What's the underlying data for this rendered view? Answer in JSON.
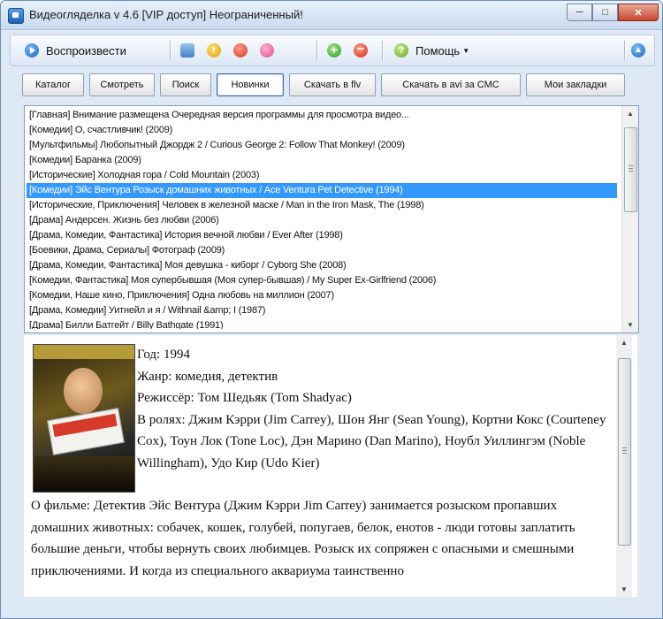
{
  "window": {
    "title": "Видеогляделка v 4.6 [VIP доступ] Неограниченный!"
  },
  "toolbar": {
    "play_label": "Воспроизвести",
    "help_label": "Помощь"
  },
  "tabs": [
    {
      "label": "Каталог"
    },
    {
      "label": "Смотреть"
    },
    {
      "label": "Поиск"
    },
    {
      "label": "Новинки"
    },
    {
      "label": "Скачать в flv"
    },
    {
      "label": "Скачать в avi за СМС"
    },
    {
      "label": "Мои закладки"
    }
  ],
  "list": {
    "selected_index": 5,
    "items": [
      "[Главная] Внимание размещена Очередная версия программы для просмотра видео...",
      "[Комедии] О, счастливчик! (2009)",
      "[Мультфильмы] Любопытный Джордж 2 / Curious George 2: Follow That Monkey! (2009)",
      "[Комедии] Баранка (2009)",
      "[Исторические] Холодная гора / Cold Mountain (2003)",
      "[Комедии] Эйс Вентура Розыск домашних животных / Ace Ventura Pet Detective (1994)",
      "[Исторические, Приключения] Человек в железной маске / Man in the Iron Mask, The (1998)",
      "[Драма] Андерсен. Жизнь без любви (2006)",
      "[Драма, Комедии, Фантастика] История вечной любви / Ever After (1998)",
      "[Боевики, Драма, Сериалы] Фотограф (2009)",
      "[Драма, Комедии, Фантастика] Моя девушка - киборг / Cyborg She (2008)",
      "[Комедии, Фантастика] Моя супербывшая (Моя супер-бывшая) / My Super Ex-Girlfriend (2006)",
      "[Комедии, Наше кино, Приключения] Одна любовь на миллион (2007)",
      "[Драма, Комедии] Уитнейл и я / Withnail &amp; I (1987)",
      "[Драма] Билли Батгейт / Billy Bathgate (1991)"
    ]
  },
  "details": {
    "year": "Год: 1994",
    "genre": "Жанр: комедия, детектив",
    "director": "Режиссёр: Том Шедьяк (Tom Shadyac)",
    "cast": "В ролях: Джим Кэрри (Jim Carrey), Шон Янг (Sean Young), Кортни Кокс (Courteney Cox), Тоун Лок (Tone Loc), Дэн Марино (Dan Marino), Ноубл Уиллингэм (Noble Willingham), Удо Кир (Udo Kier)",
    "about": "О фильме: Детектив Эйс Вентура (Джим Кэрри Jim Carrey) занимается розыском пропавших домашних животных: собачек, кошек, голубей, попугаев, белок, енотов - люди готовы заплатить большие деньги, чтобы вернуть своих любимцев. Розыск их сопряжен с опасными и смешными приключениями. И когда из специального аквариума таинственно"
  }
}
